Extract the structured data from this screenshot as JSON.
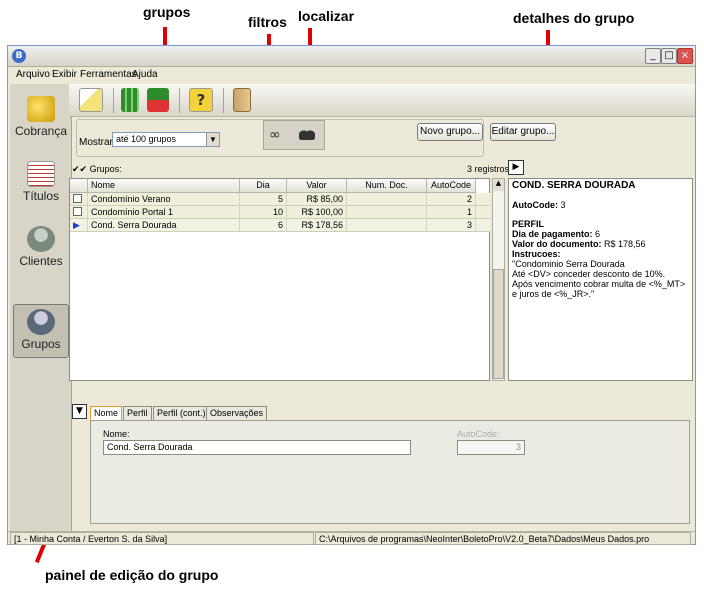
{
  "annotations": {
    "grupos": "grupos",
    "filtros": "filtros",
    "localizar": "localizar",
    "detalhes": "detalhes do grupo",
    "painel": "painel de edição do grupo"
  },
  "menu": [
    "Arquivo",
    "Exibir",
    "Ferramentas",
    "Ajuda"
  ],
  "nav": [
    {
      "label": "Cobrança",
      "icon": "coins-icon",
      "color": "#d4a200"
    },
    {
      "label": "Títulos",
      "icon": "documents-icon",
      "color": "#c0392b"
    },
    {
      "label": "Clientes",
      "icon": "person-icon",
      "color": "#7a8a7a"
    },
    {
      "label": "Grupos",
      "icon": "group-icon",
      "color": "#5a6a7a"
    }
  ],
  "filter": {
    "mostrar_label": "Mostrar:",
    "mostrar_value": "até 100 grupos",
    "novo_grupo": "Novo grupo...",
    "editar_grupo": "Editar grupo..."
  },
  "list": {
    "header_label": "Grupos:",
    "count": "3 registros",
    "columns": [
      "Nome",
      "Dia",
      "Valor",
      "Num. Doc.",
      "AutoCode"
    ],
    "rows": [
      {
        "nome": "Condomínio Verano",
        "dia": "5",
        "valor": "R$ 85,00",
        "numdoc": "",
        "autocode": "2"
      },
      {
        "nome": "Condomínio Portal 1",
        "dia": "10",
        "valor": "R$ 100,00",
        "numdoc": "",
        "autocode": "1"
      },
      {
        "nome": "Cond. Serra Dourada",
        "dia": "6",
        "valor": "R$ 178,56",
        "numdoc": "",
        "autocode": "3"
      }
    ]
  },
  "detail": {
    "title": "COND. SERRA DOURADA",
    "autocode_label": "AutoCode:",
    "autocode_value": "3",
    "perfil": "PERFIL",
    "dia_label": "Dia de pagamento:",
    "dia_value": "6",
    "valor_label": "Valor do documento:",
    "valor_value": "R$ 178,56",
    "instrucoes_label": "Instrucoes:",
    "lines": [
      "\"Condominio Serra Dourada",
      "Até <DV> conceder desconto de 10%.",
      "Após vencimento cobrar multa de <%_MT>",
      "e juros de <%_JR>.\""
    ]
  },
  "tabs": [
    "Nome",
    "Perfil",
    "Perfil (cont.)",
    "Observações"
  ],
  "edit": {
    "nome_label": "Nome:",
    "nome_value": "Cond. Serra Dourada",
    "autocode_label": "AutoCode:",
    "autocode_value": "3"
  },
  "status": {
    "account": "[1 - Minha Conta / Everton S. da Silva]",
    "path": "C:\\Arquivos de programas\\NeoInter\\BoletoPro\\V2.0_Beta7\\Dados\\Meus Dados.pro"
  }
}
